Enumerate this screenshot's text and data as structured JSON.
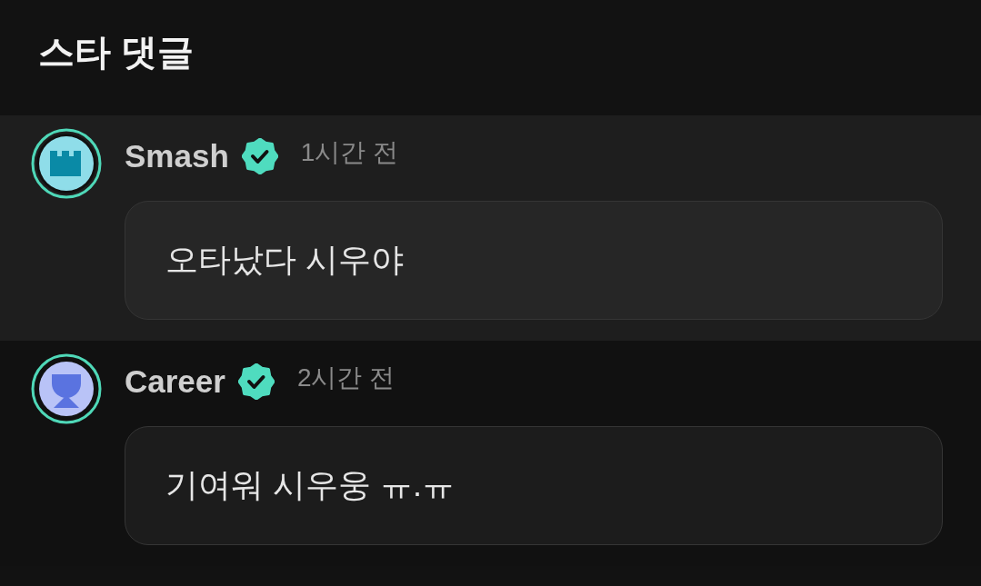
{
  "header": {
    "title": "스타 댓글"
  },
  "comments": [
    {
      "author": "Smash",
      "verified": true,
      "time": "1시간 전",
      "text": "오타났다 시우야",
      "highlighted": true,
      "avatar": {
        "kind": "tower",
        "color": "#8fdde9"
      }
    },
    {
      "author": "Career",
      "verified": true,
      "time": "2시간 전",
      "text": "기여워 시우웅 ㅠ.ㅠ",
      "highlighted": false,
      "avatar": {
        "kind": "cup",
        "color": "#b9c3f7"
      }
    }
  ]
}
